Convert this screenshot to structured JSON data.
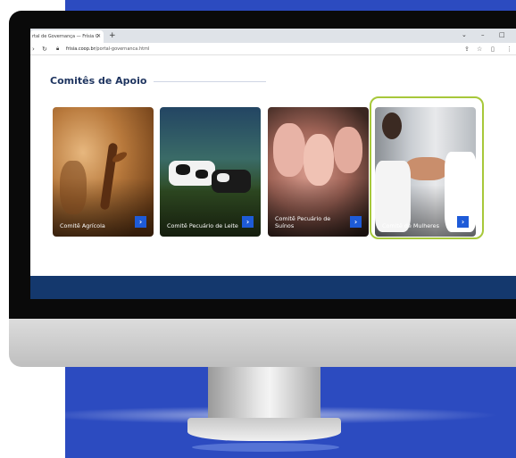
{
  "browser": {
    "tab_title": "rtal de Governança — Frísia C",
    "tab_close": "✕",
    "new_tab": "+",
    "url_host": "frisia.coop.br",
    "url_path": "/portal-governanca.html",
    "controls": [
      "⌄",
      "–",
      "□"
    ]
  },
  "section": {
    "title": "Comitês de Apoio"
  },
  "cards": [
    {
      "label": "Comitê Agrícola",
      "arrow": "›"
    },
    {
      "label": "Comitê Pecuário de Leite",
      "arrow": "›"
    },
    {
      "label": "Comitê Pecuário de Suínos",
      "arrow": "›"
    },
    {
      "label": "Comitê de Mulheres",
      "arrow": "›"
    }
  ],
  "colors": {
    "backdrop": "#2c4bc0",
    "heading": "#1f3560",
    "arrow_button": "#1e5bd8",
    "highlight": "#a7c83a",
    "footer": "#14386d"
  }
}
